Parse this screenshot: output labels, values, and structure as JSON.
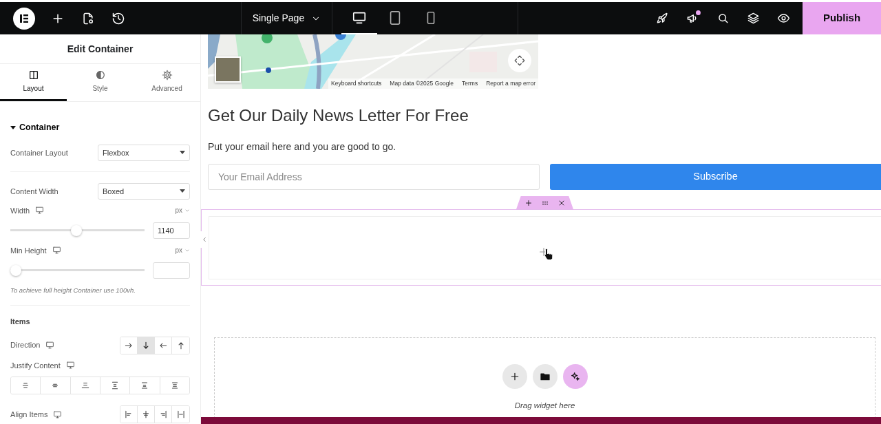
{
  "toolbar": {
    "page_menu": "Single Page",
    "devices": [
      {
        "selected": true
      },
      {
        "selected": false
      },
      {
        "selected": false
      }
    ],
    "has_notification": true,
    "publish": "Publish"
  },
  "panel": {
    "title": "Edit Container",
    "tabs": [
      {
        "label": "Layout",
        "selected": true
      },
      {
        "label": "Style",
        "selected": false
      },
      {
        "label": "Advanced",
        "selected": false
      }
    ],
    "section": {
      "title": "Container",
      "expanded": true
    },
    "controls": [
      {
        "kind": "select",
        "label": "Container Layout",
        "value": "Flexbox",
        "divider": true
      },
      {
        "kind": "select",
        "label": "Content Width",
        "value": "Boxed"
      },
      {
        "kind": "slider",
        "label": "Width",
        "unit": "px",
        "level": 0.49,
        "value": "1140"
      },
      {
        "kind": "slider",
        "label": "Min Height",
        "unit": "px",
        "level": 0
      },
      {
        "kind": "note",
        "text": "To achieve full height Container use 100vh.",
        "divider": true
      },
      {
        "kind": "heading",
        "text": "Items"
      },
      {
        "kind": "choices",
        "label": "Direction",
        "options": [
          {
            "selected": false
          },
          {
            "selected": true
          },
          {
            "selected": false
          },
          {
            "selected": false
          }
        ]
      },
      {
        "kind": "choices-wide",
        "label": "Justify Content",
        "options": [
          {
            "selected": false
          },
          {
            "selected": false
          },
          {
            "selected": false
          },
          {
            "selected": false
          },
          {
            "selected": false
          },
          {
            "selected": false
          }
        ]
      },
      {
        "kind": "choices",
        "label": "Align Items",
        "options": [
          {
            "selected": false
          },
          {
            "selected": false
          },
          {
            "selected": false
          },
          {
            "selected": false
          }
        ]
      }
    ]
  },
  "canvas": {
    "map": {
      "kind": "picture",
      "attribution": [
        "Keyboard shortcuts",
        "Map data ©2025 Google",
        "Terms",
        "Report a map error"
      ]
    },
    "heading": "Get Our Daily News Letter For Free",
    "subtitle": "Put your email here and you are good to go.",
    "email": {
      "placeholder": "Your Email Address"
    },
    "subscribe": "Subscribe",
    "dropzone": {
      "text": "Drag widget here"
    }
  }
}
